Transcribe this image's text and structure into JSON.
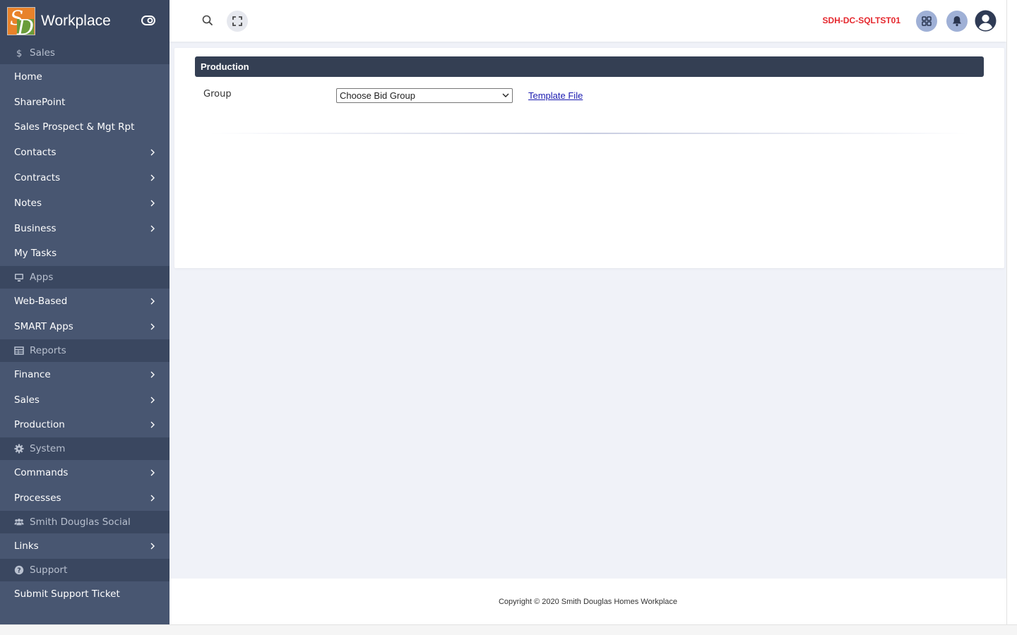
{
  "brand": {
    "title": "Workplace",
    "logo_letters": [
      "S",
      "D"
    ]
  },
  "sidebar": {
    "sections": [
      {
        "header": "Sales",
        "icon": "dollar-icon",
        "items": [
          {
            "label": "Home",
            "has_submenu": false
          },
          {
            "label": "SharePoint",
            "has_submenu": false
          },
          {
            "label": "Sales Prospect & Mgt Rpt",
            "has_submenu": false
          },
          {
            "label": "Contacts",
            "has_submenu": true
          },
          {
            "label": "Contracts",
            "has_submenu": true
          },
          {
            "label": "Notes",
            "has_submenu": true
          },
          {
            "label": "Business",
            "has_submenu": true
          },
          {
            "label": "My Tasks",
            "has_submenu": false
          }
        ]
      },
      {
        "header": "Apps",
        "icon": "desktop-icon",
        "items": [
          {
            "label": "Web-Based",
            "has_submenu": true
          },
          {
            "label": "SMART Apps",
            "has_submenu": true
          }
        ]
      },
      {
        "header": "Reports",
        "icon": "table-icon",
        "items": [
          {
            "label": "Finance",
            "has_submenu": true
          },
          {
            "label": "Sales",
            "has_submenu": true
          },
          {
            "label": "Production",
            "has_submenu": true
          }
        ]
      },
      {
        "header": "System",
        "icon": "gear-icon",
        "items": [
          {
            "label": "Commands",
            "has_submenu": true
          },
          {
            "label": "Processes",
            "has_submenu": true
          }
        ]
      },
      {
        "header": "Smith Douglas Social",
        "icon": "users-icon",
        "items": [
          {
            "label": "Links",
            "has_submenu": true
          }
        ]
      },
      {
        "header": "Support",
        "icon": "question-circle-icon",
        "items": [
          {
            "label": "Submit Support Ticket",
            "has_submenu": false
          }
        ]
      }
    ]
  },
  "topbar": {
    "server_name": "SDH-DC-SQLTST01",
    "server_color": "#e5282e"
  },
  "main": {
    "card_title": "Production",
    "group_label": "Group",
    "group_select_value": "Choose Bid Group",
    "template_link": "Template File"
  },
  "footer": {
    "copyright": "Copyright © 2020 Smith Douglas Homes Workplace"
  },
  "colors": {
    "sidebar_bg": "#485671",
    "sidebar_header_bg": "#3a4760",
    "card_header_bg": "#343f53",
    "page_bg": "#f0f2f8",
    "accent_button": "#9fb0d6"
  }
}
